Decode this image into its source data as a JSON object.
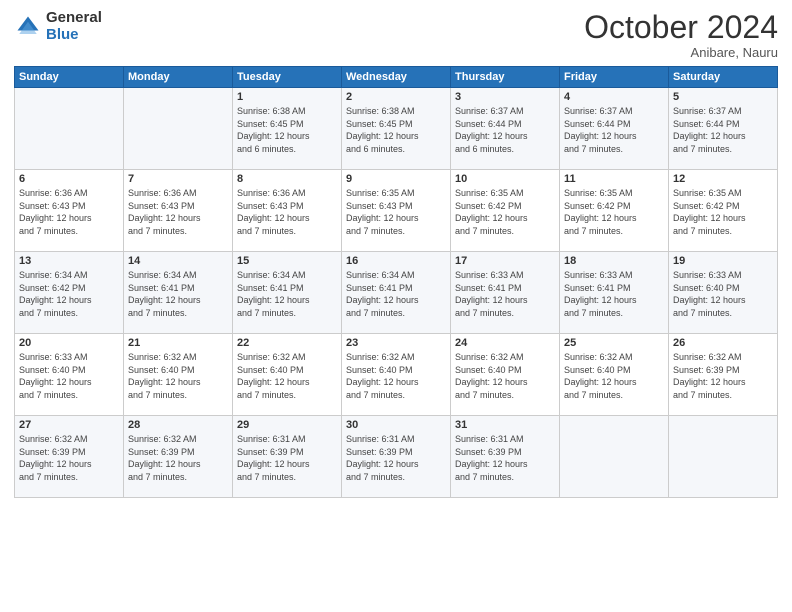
{
  "logo": {
    "general": "General",
    "blue": "Blue"
  },
  "header": {
    "month": "October 2024",
    "location": "Anibare, Nauru"
  },
  "weekdays": [
    "Sunday",
    "Monday",
    "Tuesday",
    "Wednesday",
    "Thursday",
    "Friday",
    "Saturday"
  ],
  "weeks": [
    [
      {
        "day": "",
        "info": ""
      },
      {
        "day": "",
        "info": ""
      },
      {
        "day": "1",
        "info": "Sunrise: 6:38 AM\nSunset: 6:45 PM\nDaylight: 12 hours\nand 6 minutes."
      },
      {
        "day": "2",
        "info": "Sunrise: 6:38 AM\nSunset: 6:45 PM\nDaylight: 12 hours\nand 6 minutes."
      },
      {
        "day": "3",
        "info": "Sunrise: 6:37 AM\nSunset: 6:44 PM\nDaylight: 12 hours\nand 6 minutes."
      },
      {
        "day": "4",
        "info": "Sunrise: 6:37 AM\nSunset: 6:44 PM\nDaylight: 12 hours\nand 7 minutes."
      },
      {
        "day": "5",
        "info": "Sunrise: 6:37 AM\nSunset: 6:44 PM\nDaylight: 12 hours\nand 7 minutes."
      }
    ],
    [
      {
        "day": "6",
        "info": "Sunrise: 6:36 AM\nSunset: 6:43 PM\nDaylight: 12 hours\nand 7 minutes."
      },
      {
        "day": "7",
        "info": "Sunrise: 6:36 AM\nSunset: 6:43 PM\nDaylight: 12 hours\nand 7 minutes."
      },
      {
        "day": "8",
        "info": "Sunrise: 6:36 AM\nSunset: 6:43 PM\nDaylight: 12 hours\nand 7 minutes."
      },
      {
        "day": "9",
        "info": "Sunrise: 6:35 AM\nSunset: 6:43 PM\nDaylight: 12 hours\nand 7 minutes."
      },
      {
        "day": "10",
        "info": "Sunrise: 6:35 AM\nSunset: 6:42 PM\nDaylight: 12 hours\nand 7 minutes."
      },
      {
        "day": "11",
        "info": "Sunrise: 6:35 AM\nSunset: 6:42 PM\nDaylight: 12 hours\nand 7 minutes."
      },
      {
        "day": "12",
        "info": "Sunrise: 6:35 AM\nSunset: 6:42 PM\nDaylight: 12 hours\nand 7 minutes."
      }
    ],
    [
      {
        "day": "13",
        "info": "Sunrise: 6:34 AM\nSunset: 6:42 PM\nDaylight: 12 hours\nand 7 minutes."
      },
      {
        "day": "14",
        "info": "Sunrise: 6:34 AM\nSunset: 6:41 PM\nDaylight: 12 hours\nand 7 minutes."
      },
      {
        "day": "15",
        "info": "Sunrise: 6:34 AM\nSunset: 6:41 PM\nDaylight: 12 hours\nand 7 minutes."
      },
      {
        "day": "16",
        "info": "Sunrise: 6:34 AM\nSunset: 6:41 PM\nDaylight: 12 hours\nand 7 minutes."
      },
      {
        "day": "17",
        "info": "Sunrise: 6:33 AM\nSunset: 6:41 PM\nDaylight: 12 hours\nand 7 minutes."
      },
      {
        "day": "18",
        "info": "Sunrise: 6:33 AM\nSunset: 6:41 PM\nDaylight: 12 hours\nand 7 minutes."
      },
      {
        "day": "19",
        "info": "Sunrise: 6:33 AM\nSunset: 6:40 PM\nDaylight: 12 hours\nand 7 minutes."
      }
    ],
    [
      {
        "day": "20",
        "info": "Sunrise: 6:33 AM\nSunset: 6:40 PM\nDaylight: 12 hours\nand 7 minutes."
      },
      {
        "day": "21",
        "info": "Sunrise: 6:32 AM\nSunset: 6:40 PM\nDaylight: 12 hours\nand 7 minutes."
      },
      {
        "day": "22",
        "info": "Sunrise: 6:32 AM\nSunset: 6:40 PM\nDaylight: 12 hours\nand 7 minutes."
      },
      {
        "day": "23",
        "info": "Sunrise: 6:32 AM\nSunset: 6:40 PM\nDaylight: 12 hours\nand 7 minutes."
      },
      {
        "day": "24",
        "info": "Sunrise: 6:32 AM\nSunset: 6:40 PM\nDaylight: 12 hours\nand 7 minutes."
      },
      {
        "day": "25",
        "info": "Sunrise: 6:32 AM\nSunset: 6:40 PM\nDaylight: 12 hours\nand 7 minutes."
      },
      {
        "day": "26",
        "info": "Sunrise: 6:32 AM\nSunset: 6:39 PM\nDaylight: 12 hours\nand 7 minutes."
      }
    ],
    [
      {
        "day": "27",
        "info": "Sunrise: 6:32 AM\nSunset: 6:39 PM\nDaylight: 12 hours\nand 7 minutes."
      },
      {
        "day": "28",
        "info": "Sunrise: 6:32 AM\nSunset: 6:39 PM\nDaylight: 12 hours\nand 7 minutes."
      },
      {
        "day": "29",
        "info": "Sunrise: 6:31 AM\nSunset: 6:39 PM\nDaylight: 12 hours\nand 7 minutes."
      },
      {
        "day": "30",
        "info": "Sunrise: 6:31 AM\nSunset: 6:39 PM\nDaylight: 12 hours\nand 7 minutes."
      },
      {
        "day": "31",
        "info": "Sunrise: 6:31 AM\nSunset: 6:39 PM\nDaylight: 12 hours\nand 7 minutes."
      },
      {
        "day": "",
        "info": ""
      },
      {
        "day": "",
        "info": ""
      }
    ]
  ]
}
